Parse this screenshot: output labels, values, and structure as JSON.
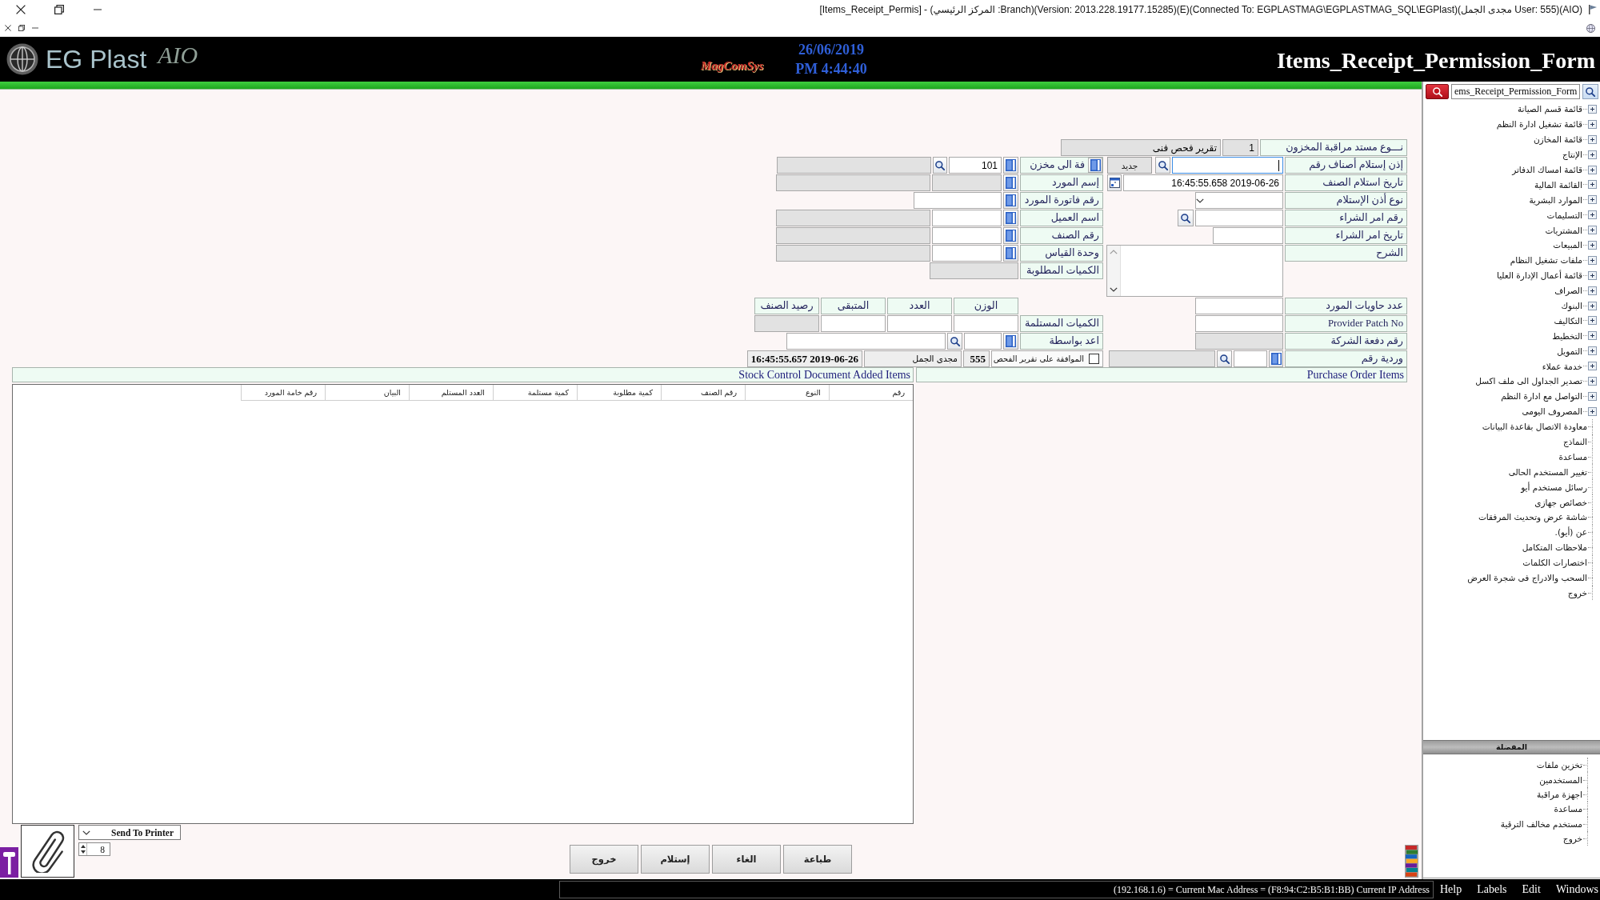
{
  "window": {
    "title": "[Items_Receipt_Permis] - (المركز الرئيسي :Branch)(Version: 2013.228.19177.15285)(E)(Connected To: EGPLASTMAG\\EGPLASTMAG_SQL\\EGPlast)(مجدى الجمل User: 555)(AIO)"
  },
  "header": {
    "logo": "EG Plast",
    "logo_tag": "AIO",
    "vendor_logo": "MagComSys",
    "date": "26/06/2019",
    "time": "PM 4:44:40",
    "form_title": "Items_Receipt_Permission_Form"
  },
  "form": {
    "document_type": {
      "label": "نـــوع مستد مراقبة المخزون",
      "fields": [
        {
          "value": "1",
          "disabled": true
        },
        {
          "value": "تقرير فحص فنى",
          "disabled": true
        }
      ]
    },
    "right_rows": [
      {
        "kind": "number",
        "label": "إذن إستلام أصناف رقم",
        "fields": [
          {
            "disabled": false,
            "focused": true
          }
        ],
        "button": "جديد"
      },
      {
        "kind": "datetime",
        "label": "تاريخ استلام الصنف",
        "fields": [
          {
            "value": "16:45:55.658 2019-06-26",
            "disabled": false
          }
        ]
      },
      {
        "kind": "dropdown",
        "label": "نوع أذن الإستلام",
        "fields": [
          {
            "disabled": false
          }
        ]
      },
      {
        "kind": "search",
        "label": "رقم امر الشراء",
        "fields": [
          {
            "disabled": false
          }
        ]
      },
      {
        "kind": "date",
        "label": "تاريخ امر الشراء",
        "fields": [
          {
            "disabled": false
          }
        ]
      },
      {
        "kind": "memo",
        "label": "الشرح",
        "fields": [
          {
            "disabled": false
          }
        ]
      },
      {
        "kind": "text",
        "label": "عدد حاويات المورد",
        "fields": [
          {
            "disabled": false
          }
        ]
      },
      {
        "kind": "text",
        "label": "Provider Patch No",
        "fields": [
          {
            "disabled": false
          }
        ]
      },
      {
        "kind": "text",
        "label": "رقم دفعة الشركة",
        "fields": [
          {
            "disabled": true
          }
        ]
      },
      {
        "kind": "shift",
        "label": "وردية رقم",
        "fields": [
          {
            "disabled": false
          },
          {
            "disabled": true
          }
        ]
      }
    ],
    "left_rows": [
      {
        "kind": "store",
        "label": "فة الى مخزن",
        "fields": [
          {
            "value": "101",
            "disabled": false
          },
          {
            "disabled": true
          }
        ]
      },
      {
        "kind": "lookup",
        "label": "إسم المورد",
        "fields": [
          {
            "disabled": true
          },
          {
            "disabled": true
          }
        ]
      },
      {
        "kind": "lookup-single",
        "label": "رقم فاتورة المورد",
        "fields": [
          {
            "disabled": false
          }
        ]
      },
      {
        "kind": "lookup",
        "label": "اسم العميل",
        "fields": [
          {
            "disabled": false
          },
          {
            "disabled": true
          }
        ]
      },
      {
        "kind": "lookup",
        "label": "رقم الصنف",
        "fields": [
          {
            "disabled": false
          },
          {
            "disabled": true
          }
        ]
      },
      {
        "kind": "lookup",
        "label": "وحدة القياس",
        "fields": [
          {
            "disabled": false
          },
          {
            "disabled": true
          }
        ]
      },
      {
        "kind": "readonly",
        "label": "الكميات المطلوبة",
        "fields": [
          {
            "disabled": true
          }
        ]
      },
      {
        "kind": "headings",
        "headings": [
          "الوزن",
          "العدد",
          "المتبقى",
          "رصيد الصنف"
        ]
      },
      {
        "kind": "quantities",
        "label": "الكميات المستلمة",
        "fields": [
          {
            "disabled": false
          },
          {
            "disabled": false
          },
          {
            "disabled": false
          },
          {
            "disabled": true
          }
        ]
      },
      {
        "kind": "prepared-by",
        "label": "اعد بواسطة",
        "fields": [
          {
            "disabled": false
          },
          {
            "disabled": false
          }
        ]
      },
      {
        "kind": "approval",
        "label": "الموافقة على تقرير الفحص",
        "checked": false,
        "user_code": "555",
        "user_name": "مجدى الجمل",
        "timestamp": "16:45:55.657 2019-06-26"
      }
    ]
  },
  "sections": {
    "purchase_order_items": {
      "title": "Purchase Order Items"
    },
    "added_items": {
      "title": "Stock Control Document Added Items",
      "table": {
        "columns": [
          "رقم",
          "النوع",
          "رقم الصنف",
          "كمية مطلوبة",
          "كمية مستلمة",
          "العدد المستلم",
          "البيان",
          "رقم خامة المورد"
        ]
      }
    }
  },
  "bottom_bar": {
    "printer": {
      "value": "Send To Printer"
    },
    "copies": {
      "value": "8"
    },
    "buttons": [
      "طباعة",
      "الغاء",
      "إستلام",
      "خروج"
    ]
  },
  "sidebar": {
    "search": {
      "value": "ems_Receipt_Permission_Form"
    },
    "tree": [
      {
        "kind": "group",
        "label": "قائمة قسم الصيانة",
        "expanded": false
      },
      {
        "kind": "group",
        "label": "قائمة تشغيل ادارة النظم",
        "expanded": false
      },
      {
        "kind": "group",
        "label": "قائمة المخازن",
        "expanded": false
      },
      {
        "kind": "group",
        "label": "الإنتاج",
        "expanded": false
      },
      {
        "kind": "group",
        "label": "قائمة امساك الدفاتر",
        "expanded": false
      },
      {
        "kind": "group",
        "label": "القائمة المالية",
        "expanded": false
      },
      {
        "kind": "group",
        "label": "الموارد البشرية",
        "expanded": false
      },
      {
        "kind": "group",
        "label": "التسليمات",
        "expanded": false
      },
      {
        "kind": "group",
        "label": "المشتريات",
        "expanded": false
      },
      {
        "kind": "group",
        "label": "المبيعات",
        "expanded": false
      },
      {
        "kind": "group",
        "label": "ملفات تشغيل النظام",
        "expanded": false
      },
      {
        "kind": "group",
        "label": "قائمة أعمال الإدارة العليا",
        "expanded": false
      },
      {
        "kind": "group",
        "label": "الصراف",
        "expanded": false
      },
      {
        "kind": "group",
        "label": "البنوك",
        "expanded": false
      },
      {
        "kind": "group",
        "label": "التكاليف",
        "expanded": false
      },
      {
        "kind": "group",
        "label": "التخطيط",
        "expanded": false
      },
      {
        "kind": "group",
        "label": "التمويل",
        "expanded": false
      },
      {
        "kind": "group",
        "label": "خدمة عملاء",
        "expanded": false
      },
      {
        "kind": "group",
        "label": "تصدير الجداول الى ملف اكسل",
        "expanded": false
      },
      {
        "kind": "group",
        "label": "التواصل مع ادارة النظم",
        "expanded": false
      },
      {
        "kind": "group",
        "label": "المصروف اليومى",
        "expanded": false
      },
      {
        "kind": "leaf",
        "label": "معاودة الاتصال بقاعدة البيانات"
      },
      {
        "kind": "leaf",
        "label": "النماذج"
      },
      {
        "kind": "leaf",
        "label": "مساعدة"
      },
      {
        "kind": "leaf",
        "label": "تغيير المستخدم الحالى"
      },
      {
        "kind": "leaf",
        "label": "رسائل مستخدم أيو"
      },
      {
        "kind": "leaf",
        "label": "خصائص جهازى"
      },
      {
        "kind": "leaf",
        "label": "شاشة عرض وتحديث المرفقات"
      },
      {
        "kind": "leaf",
        "label": "عن (أيو)."
      },
      {
        "kind": "leaf",
        "label": "ملاحظات المتكامل"
      },
      {
        "kind": "leaf",
        "label": "اختصارات الكلمات"
      },
      {
        "kind": "leaf",
        "label": "السحب والادراج فى شجرة العرض"
      },
      {
        "kind": "leaf",
        "label": "خروج"
      }
    ],
    "favorites": {
      "title": "المفضلة",
      "items": [
        "تخزين ملفات",
        "المستخدمين",
        "اجهزة مراقبة",
        "مساعدة",
        "مستخدم مخالف الترقية",
        "خروج"
      ]
    }
  },
  "status_bar": {
    "text": "(192.168.1.6) = Current Mac Address = (F8:94:C2:B5:B1:BB) Current IP Address",
    "menu": [
      "Windows",
      "Edit",
      "Labels",
      "Help"
    ]
  }
}
